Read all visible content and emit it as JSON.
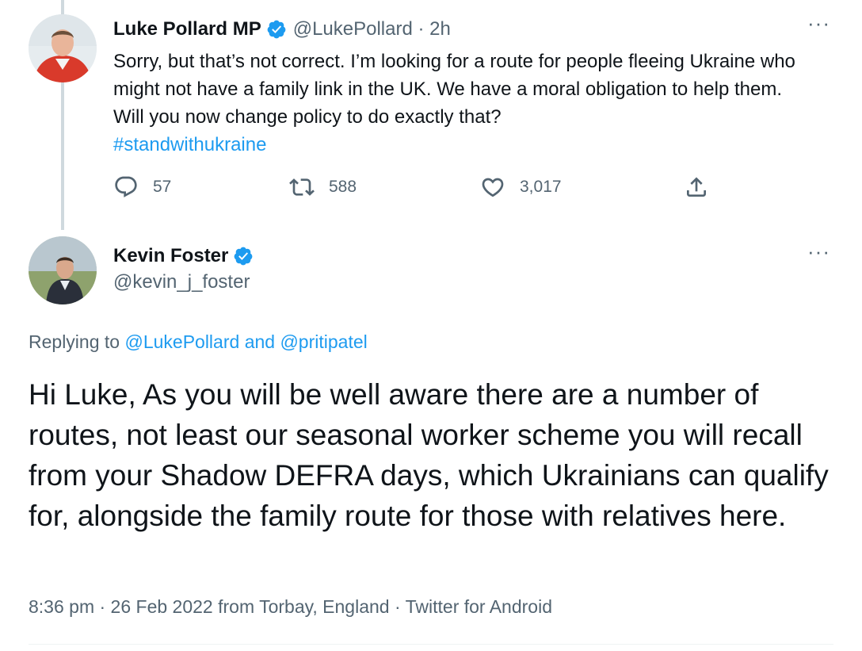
{
  "thread": {
    "tweet1": {
      "name": "Luke Pollard MP",
      "handle_time": "@LukePollard · 2h",
      "body": "Sorry, but that’s not correct. I’m looking for a route for people fleeing Ukraine who might not have a family link in the UK. We have a moral obligation to help them. Will you now change policy to do exactly that?",
      "hashtag": "#standwithukraine",
      "replies": "57",
      "retweets": "588",
      "likes": "3,017",
      "more": "···"
    },
    "tweet2": {
      "name": "Kevin Foster",
      "handle": "@kevin_j_foster",
      "more": "···",
      "replying_prefix": "Replying to",
      "replying_to_1": "@LukePollard",
      "replying_and": "and",
      "replying_to_2": "@pritipatel",
      "body": "Hi Luke, As you will be well aware there are a number of routes, not least our seasonal worker scheme you will recall from your Shadow DEFRA days, which Ukrainians can qualify for, alongside the family route for those with relatives here.",
      "timestamp": "8:36 pm · 26 Feb 2022 from Torbay, England · ",
      "source": "Twitter for Android"
    }
  },
  "icons": {
    "verified": "verified-badge-icon",
    "reply": "reply-icon",
    "retweet": "retweet-icon",
    "like": "like-heart-icon",
    "share": "share-icon"
  },
  "colors": {
    "accent": "#1d9bf0",
    "muted_text": "#536471",
    "primary_text": "#0f1419",
    "thread_line": "#cfd9de"
  }
}
